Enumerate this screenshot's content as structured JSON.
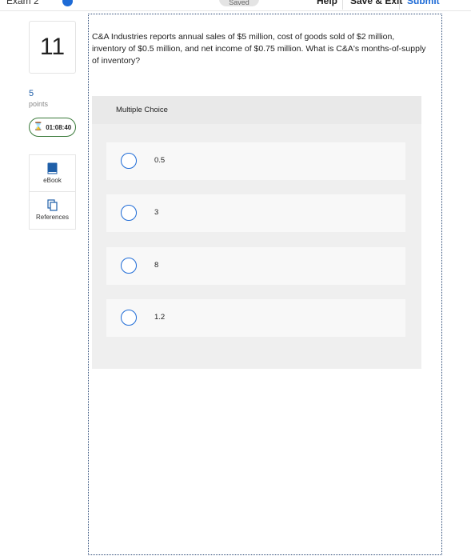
{
  "header": {
    "exam_title": "Exam 2",
    "saved_label": "Saved",
    "help": "Help",
    "save_exit": "Save & Exit",
    "submit": "Submit"
  },
  "sidebar": {
    "question_number": "11",
    "points_value": "5",
    "points_label": "points",
    "timer": "01:08:40",
    "tools": [
      {
        "label": "eBook",
        "icon": "book-icon"
      },
      {
        "label": "References",
        "icon": "copy-pages-icon"
      }
    ]
  },
  "question": {
    "text": "C&A Industries reports annual sales of $5 million, cost of goods sold of $2 million, inventory of $0.5 million, and net income of $0.75 million. What is C&A's months-of-supply of inventory?"
  },
  "multiple_choice": {
    "header": "Multiple Choice",
    "options": [
      "0.5",
      "3",
      "8",
      "1.2"
    ]
  },
  "colors": {
    "accent": "#1e6bd6",
    "timer_border": "#3a7a3a",
    "points": "#1f5fa8",
    "frame_border": "#2b4a77"
  }
}
